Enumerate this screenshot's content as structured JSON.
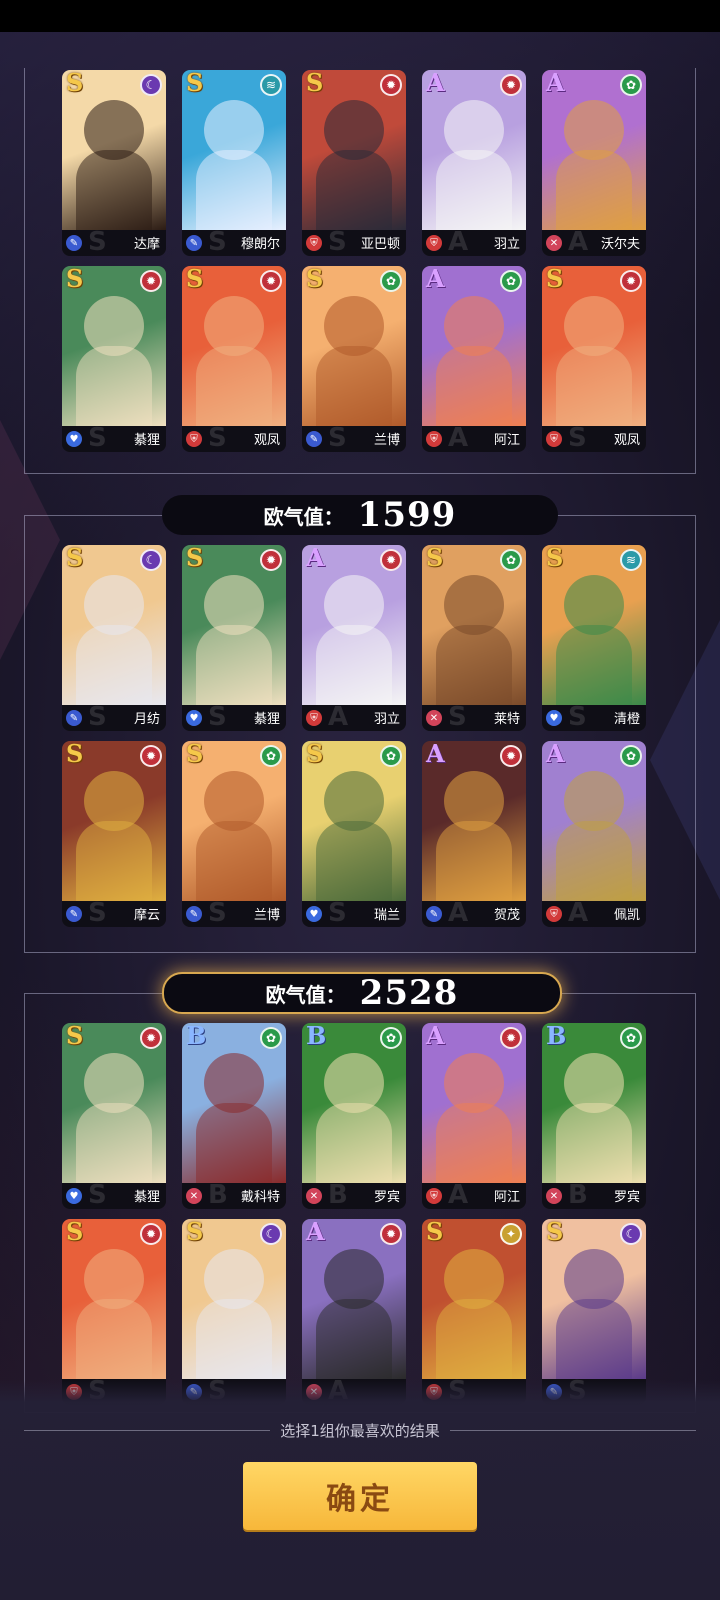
{
  "colors": {
    "S": "#f5c84a",
    "A": "#d9a0ff",
    "B": "#8ab6ff",
    "fire": "#c0303a",
    "water": "#2a9aa8",
    "wind": "#2a9a4a",
    "dark": "#6a3ab0",
    "light": "#c9a030",
    "tank": "#d23a3a",
    "support": "#3a6adf",
    "dps": "#d2445a",
    "mage": "#3a5ad0"
  },
  "groups": [
    {
      "score_label": "",
      "score": "",
      "selected": false,
      "cards": [
        {
          "rank": "S",
          "element": "dark",
          "role": "mage",
          "name": "达摩",
          "art": [
            "#f4d9a8",
            "#2b1b14"
          ]
        },
        {
          "rank": "S",
          "element": "water",
          "role": "mage",
          "name": "穆朗尔",
          "art": [
            "#3aa7d9",
            "#e8f0ff"
          ]
        },
        {
          "rank": "S",
          "element": "fire",
          "role": "tank",
          "name": "亚巴顿",
          "art": [
            "#c04a3a",
            "#2a2a38"
          ]
        },
        {
          "rank": "A",
          "element": "fire",
          "role": "tank",
          "name": "羽立",
          "art": [
            "#b8a0e0",
            "#f5f5f5"
          ]
        },
        {
          "rank": "A",
          "element": "wind",
          "role": "dps",
          "name": "沃尔夫",
          "art": [
            "#b070d0",
            "#e0a040"
          ]
        },
        {
          "rank": "S",
          "element": "fire",
          "role": "support",
          "name": "綦狸",
          "art": [
            "#4a8a5a",
            "#f0e0c0"
          ]
        },
        {
          "rank": "S",
          "element": "fire",
          "role": "tank",
          "name": "观凤",
          "art": [
            "#e8603a",
            "#f0b080"
          ]
        },
        {
          "rank": "S",
          "element": "wind",
          "role": "mage",
          "name": "兰博",
          "art": [
            "#f5b070",
            "#b05a2a"
          ]
        },
        {
          "rank": "A",
          "element": "wind",
          "role": "tank",
          "name": "阿江",
          "art": [
            "#a070d0",
            "#f08050"
          ]
        },
        {
          "rank": "S",
          "element": "fire",
          "role": "tank",
          "name": "观凤",
          "art": [
            "#e8603a",
            "#f0b080"
          ]
        }
      ]
    },
    {
      "score_label": "欧气值：",
      "score": "1599",
      "selected": false,
      "cards": [
        {
          "rank": "S",
          "element": "dark",
          "role": "mage",
          "name": "月纺",
          "art": [
            "#f0c890",
            "#e8e8f0"
          ]
        },
        {
          "rank": "S",
          "element": "fire",
          "role": "support",
          "name": "綦狸",
          "art": [
            "#4a8a5a",
            "#f0e0c0"
          ]
        },
        {
          "rank": "A",
          "element": "fire",
          "role": "tank",
          "name": "羽立",
          "art": [
            "#b8a0e0",
            "#f5f5f5"
          ]
        },
        {
          "rank": "S",
          "element": "wind",
          "role": "dps",
          "name": "莱特",
          "art": [
            "#e0a060",
            "#7a4a2a"
          ]
        },
        {
          "rank": "S",
          "element": "water",
          "role": "support",
          "name": "清橙",
          "art": [
            "#e8a050",
            "#3a8a4a"
          ]
        },
        {
          "rank": "S",
          "element": "fire",
          "role": "mage",
          "name": "摩云",
          "art": [
            "#8a3a2a",
            "#e0b040"
          ]
        },
        {
          "rank": "S",
          "element": "wind",
          "role": "mage",
          "name": "兰博",
          "art": [
            "#f5b070",
            "#b05a2a"
          ]
        },
        {
          "rank": "S",
          "element": "wind",
          "role": "support",
          "name": "瑞兰",
          "art": [
            "#e8d070",
            "#4a6a3a"
          ]
        },
        {
          "rank": "A",
          "element": "fire",
          "role": "mage",
          "name": "贺茂",
          "art": [
            "#5a2a2a",
            "#e0a040"
          ]
        },
        {
          "rank": "A",
          "element": "wind",
          "role": "tank",
          "name": "佩凯",
          "art": [
            "#a080d0",
            "#c0a040"
          ]
        }
      ]
    },
    {
      "score_label": "欧气值：",
      "score": "2528",
      "selected": true,
      "cards": [
        {
          "rank": "S",
          "element": "fire",
          "role": "support",
          "name": "綦狸",
          "art": [
            "#4a8a5a",
            "#f0e0c0"
          ]
        },
        {
          "rank": "B",
          "element": "wind",
          "role": "dps",
          "name": "戴科特",
          "art": [
            "#8ab0e0",
            "#8a2a2a"
          ]
        },
        {
          "rank": "B",
          "element": "wind",
          "role": "dps",
          "name": "罗宾",
          "art": [
            "#3a8a3a",
            "#f0e0b0"
          ]
        },
        {
          "rank": "A",
          "element": "fire",
          "role": "tank",
          "name": "阿江",
          "art": [
            "#a070d0",
            "#f08050"
          ]
        },
        {
          "rank": "B",
          "element": "wind",
          "role": "dps",
          "name": "罗宾",
          "art": [
            "#3a8a3a",
            "#f0e0b0"
          ]
        },
        {
          "rank": "S",
          "element": "fire",
          "role": "tank",
          "name": "",
          "art": [
            "#e8603a",
            "#f0b080"
          ]
        },
        {
          "rank": "S",
          "element": "dark",
          "role": "mage",
          "name": "",
          "art": [
            "#f0c890",
            "#e8e8f0"
          ]
        },
        {
          "rank": "A",
          "element": "fire",
          "role": "dps",
          "name": "",
          "art": [
            "#8a70c0",
            "#2a2a2a"
          ]
        },
        {
          "rank": "S",
          "element": "light",
          "role": "tank",
          "name": "",
          "art": [
            "#c05030",
            "#e0b040"
          ]
        },
        {
          "rank": "S",
          "element": "dark",
          "role": "mage",
          "name": "",
          "art": [
            "#f0c0a0",
            "#5a3a8a"
          ]
        }
      ]
    }
  ],
  "hint": "选择1组你最喜欢的结果",
  "confirm_label": "确定"
}
